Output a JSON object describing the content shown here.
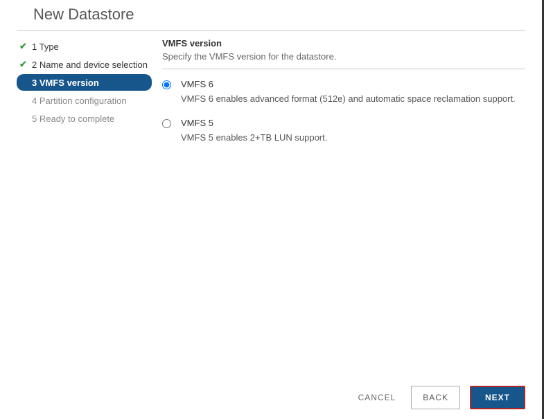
{
  "dialog": {
    "title": "New Datastore"
  },
  "sidebar": {
    "steps": [
      {
        "label": "1 Type",
        "state": "done"
      },
      {
        "label": "2 Name and device selection",
        "state": "done"
      },
      {
        "label": "3 VMFS version",
        "state": "active"
      },
      {
        "label": "4 Partition configuration",
        "state": "pending"
      },
      {
        "label": "5 Ready to complete",
        "state": "pending"
      }
    ]
  },
  "main": {
    "title": "VMFS version",
    "description": "Specify the VMFS version for the datastore.",
    "options": [
      {
        "label": "VMFS 6",
        "help": "VMFS 6 enables advanced format (512e) and automatic space reclamation support.",
        "selected": true
      },
      {
        "label": "VMFS 5",
        "help": "VMFS 5 enables 2+TB LUN support.",
        "selected": false
      }
    ]
  },
  "footer": {
    "cancel": "CANCEL",
    "back": "BACK",
    "next": "NEXT"
  }
}
